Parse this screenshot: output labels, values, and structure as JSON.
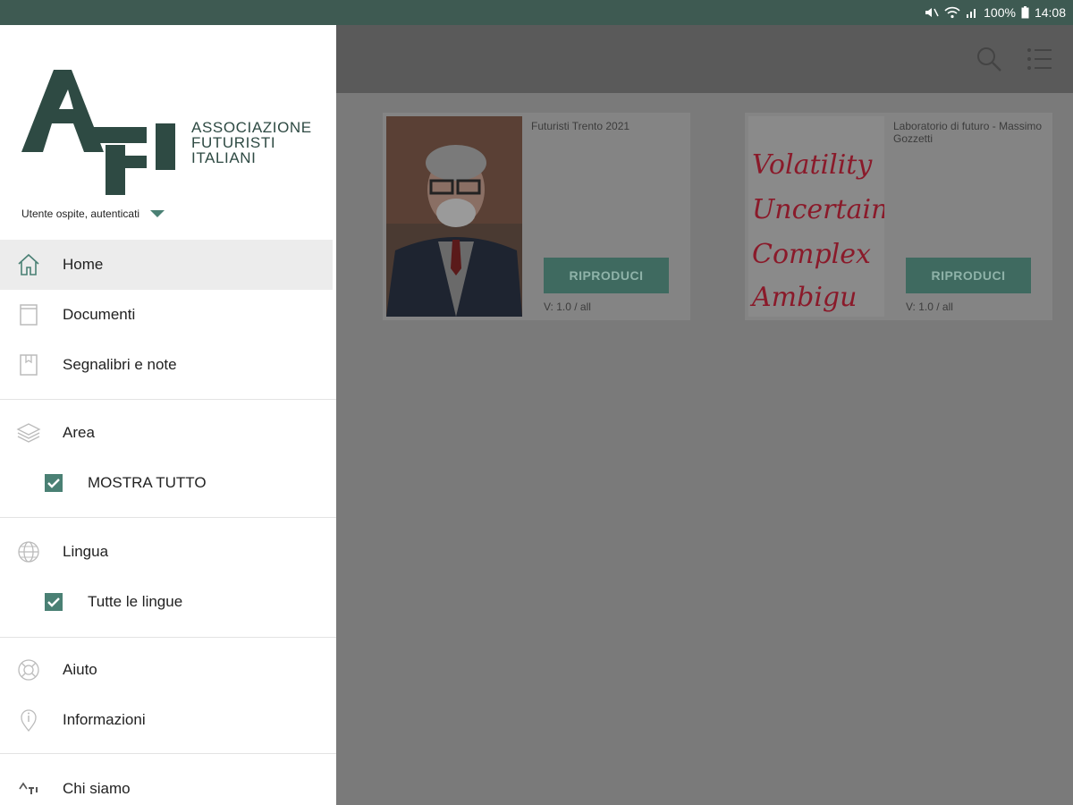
{
  "status": {
    "battery": "100%",
    "time": "14:08"
  },
  "drawer": {
    "logo_lines": [
      "ASSOCIAZIONE",
      "FUTURISTI",
      "ITALIANI"
    ],
    "user_label": "Utente ospite, autenticati",
    "items": {
      "home": "Home",
      "documenti": "Documenti",
      "segnalibri": "Segnalibri e note",
      "area": "Area",
      "mostra_tutto": "MOSTRA TUTTO",
      "lingua": "Lingua",
      "tutte_lingue": "Tutte le lingue",
      "aiuto": "Aiuto",
      "informazioni": "Informazioni",
      "chi_siamo": "Chi siamo"
    }
  },
  "cards": [
    {
      "title": "Futuristi Trento 2021",
      "button": "RIPRODUCI",
      "version": "V: 1.0 / all"
    },
    {
      "title": "Laboratorio di futuro - Massimo Gozzetti",
      "button": "RIPRODUCI",
      "version": "V: 1.0 / all",
      "thumb_words": [
        "Volatility",
        "Uncertain",
        "Complex",
        "Ambigu"
      ]
    }
  ]
}
